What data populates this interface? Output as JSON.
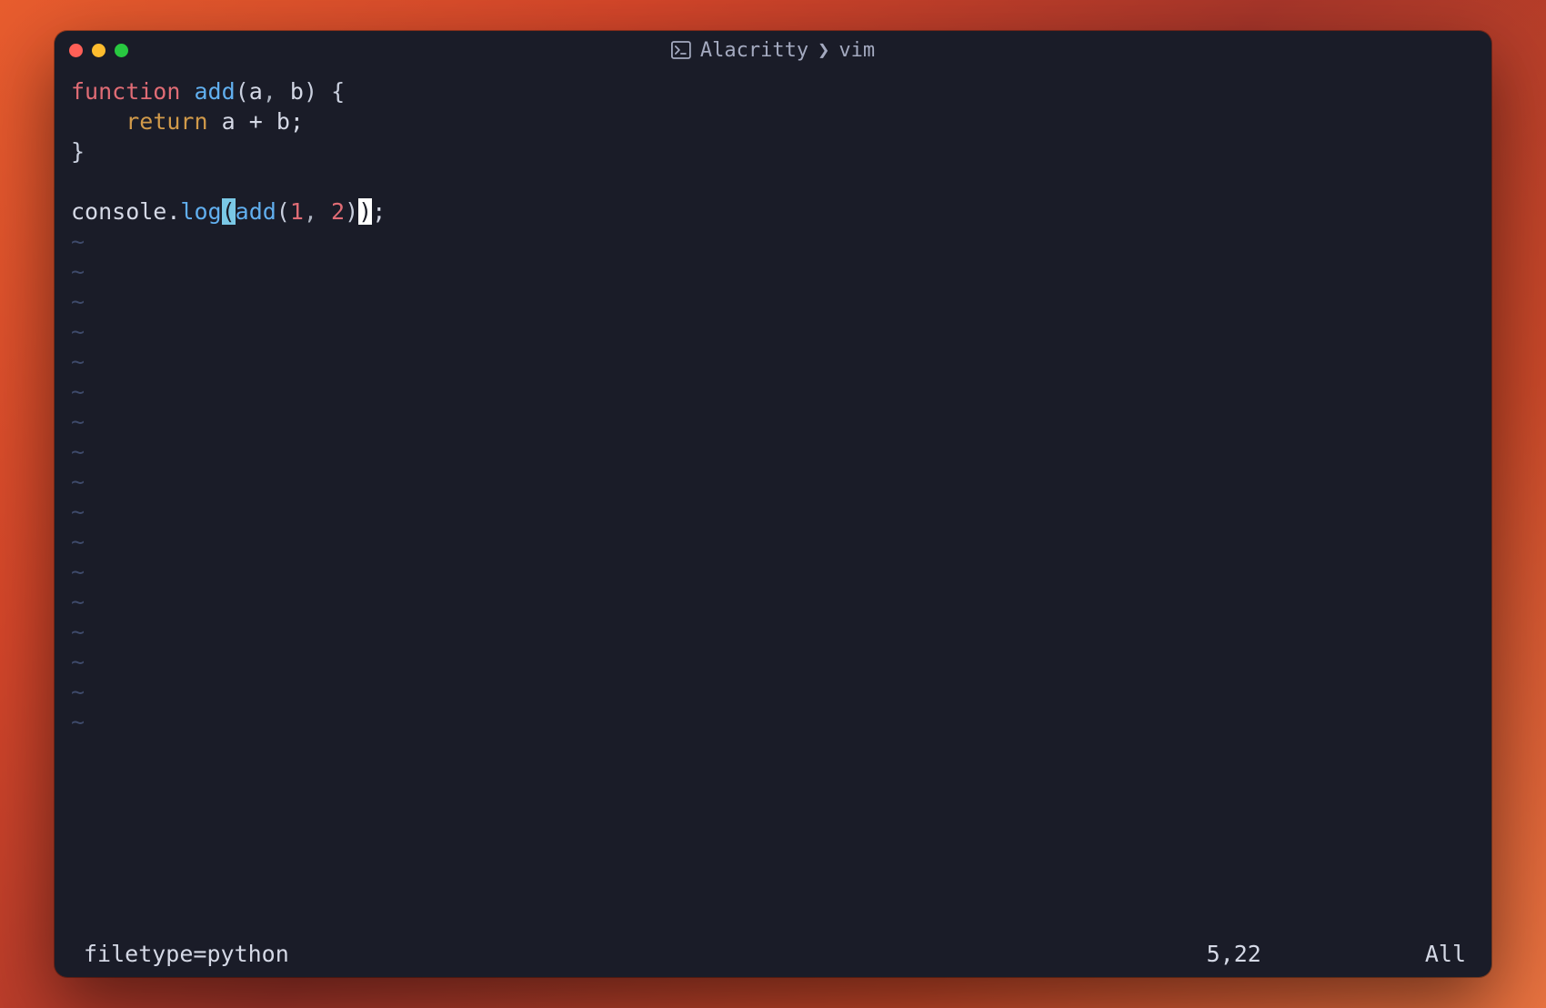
{
  "title": {
    "app": "Alacritty",
    "separator": "❯",
    "context": "vim"
  },
  "code": {
    "l1": {
      "kw": "function",
      "fn": "add",
      "open": "(",
      "a": "a",
      "c1": ",",
      "sp": " ",
      "b": "b",
      "close": ")",
      "sp2": " ",
      "brace": "{"
    },
    "l2": {
      "indent": "    ",
      "ret": "return",
      "sp": " ",
      "a": "a",
      "sp2": " ",
      "op": "+",
      "sp3": " ",
      "b": "b",
      "semi": ";"
    },
    "l3": {
      "brace": "}"
    },
    "l4": "",
    "l5": {
      "obj": "console",
      "dot": ".",
      "method": "log",
      "mopen": "(",
      "call": "add",
      "copen": "(",
      "n1": "1",
      "comma": ",",
      "sp": " ",
      "n2": "2",
      "cclose": ")",
      "mclose": ")",
      "semi": ";"
    }
  },
  "tilde": "~",
  "tilde_count": 17,
  "status": {
    "left": "filetype=python",
    "pos": "5,22",
    "view": "All"
  }
}
